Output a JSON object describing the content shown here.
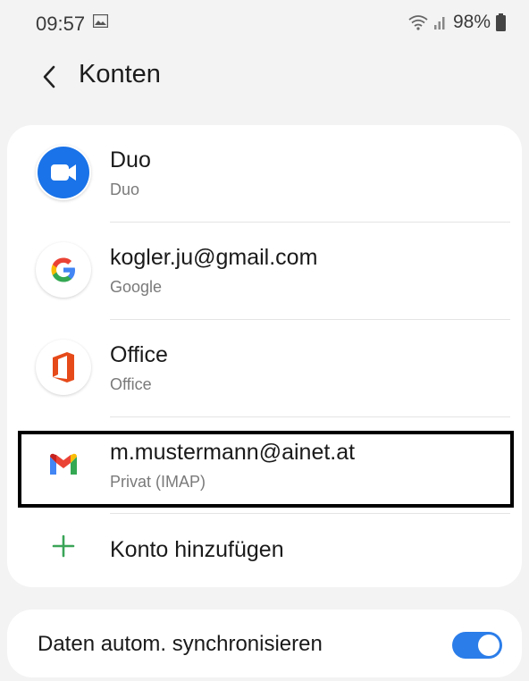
{
  "status_bar": {
    "time": "09:57",
    "battery": "98%"
  },
  "header": {
    "title": "Konten"
  },
  "accounts": [
    {
      "title": "Duo",
      "subtitle": "Duo",
      "icon": "duo-icon"
    },
    {
      "title": "kogler.ju@gmail.com",
      "subtitle": "Google",
      "icon": "google-icon"
    },
    {
      "title": "Office",
      "subtitle": "Office",
      "icon": "office-icon"
    },
    {
      "title": "m.mustermann@ainet.at",
      "subtitle": "Privat (IMAP)",
      "icon": "gmail-icon"
    }
  ],
  "add_account": {
    "label": "Konto hinzufügen"
  },
  "sync": {
    "label": "Daten autom. synchronisieren",
    "enabled": true
  },
  "colors": {
    "accent": "#2b7de9",
    "add_green": "#3aa457",
    "background": "#f3f3f3"
  }
}
